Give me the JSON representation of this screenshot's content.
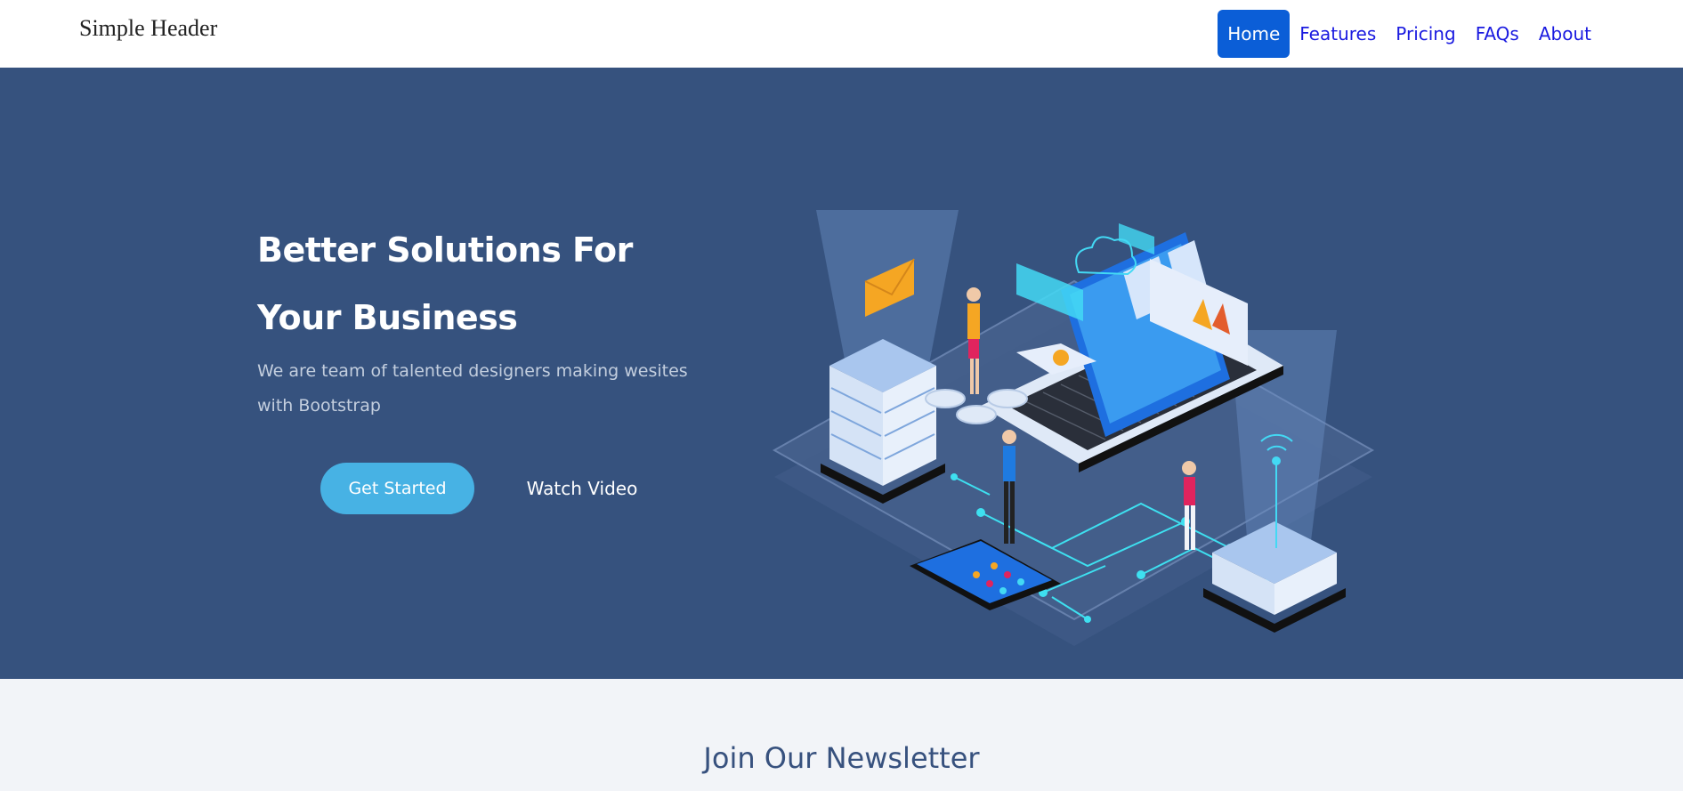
{
  "header": {
    "brand": "Simple Header",
    "nav": {
      "home": "Home",
      "features": "Features",
      "pricing": "Pricing",
      "faqs": "FAQs",
      "about": "About"
    }
  },
  "hero": {
    "title": "Better Solutions For Your Business",
    "subtitle": "We are team of talented designers making wesites with Bootstrap",
    "cta_primary": "Get Started",
    "cta_secondary": "Watch Video"
  },
  "newsletter": {
    "title": "Join Our Newsletter"
  },
  "colors": {
    "hero_bg": "#36527e",
    "accent": "#47b2e4",
    "nav_active": "#0b5ed7",
    "nav_link": "#1a1ae0"
  }
}
